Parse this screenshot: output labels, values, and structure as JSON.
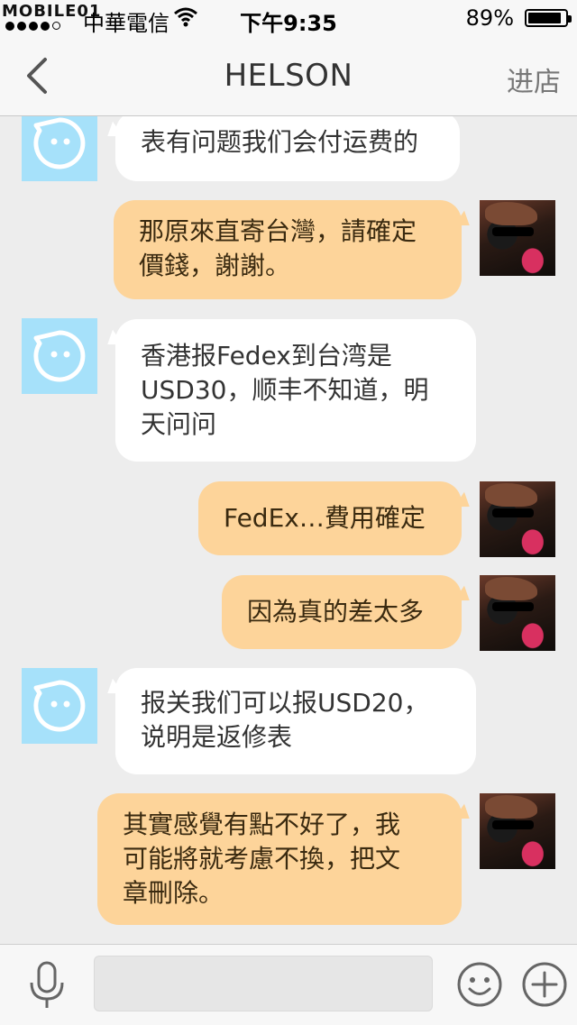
{
  "status_bar": {
    "watermark": "MOBILE01",
    "carrier": "中華電信",
    "time": "下午9:35",
    "battery_percent": "89%",
    "battery_level": 0.89
  },
  "nav": {
    "back_icon": "chevron-left-icon",
    "title": "HELSON",
    "right_action": "进店"
  },
  "messages": [
    {
      "side": "bot",
      "lines": [
        "表有问题我们会付运费的"
      ]
    },
    {
      "side": "user",
      "lines": [
        "那原來直寄台灣，請確定",
        "價錢，謝謝。"
      ]
    },
    {
      "side": "bot",
      "lines": [
        "香港报Fedex到台湾是",
        "USD30，顺丰不知道，明",
        "天问问"
      ]
    },
    {
      "side": "user",
      "lines": [
        "FedEx…費用確定"
      ]
    },
    {
      "side": "user",
      "lines": [
        "因為真的差太多"
      ]
    },
    {
      "side": "bot",
      "lines": [
        "报关我们可以报USD20，",
        "说明是返修表"
      ]
    },
    {
      "side": "user",
      "lines": [
        "其實感覺有點不好了，我",
        "可能將就考慮不換，把文",
        "章刪除。"
      ]
    }
  ],
  "input_bar": {
    "mic_icon": "microphone-icon",
    "input_value": "",
    "emoji_icon": "smiley-icon",
    "plus_icon": "plus-circle-icon"
  },
  "colors": {
    "bot_bubble": "#ffffff",
    "user_bubble": "#fdd49a",
    "bot_avatar": "#a6e1fa",
    "background": "#ededed"
  }
}
